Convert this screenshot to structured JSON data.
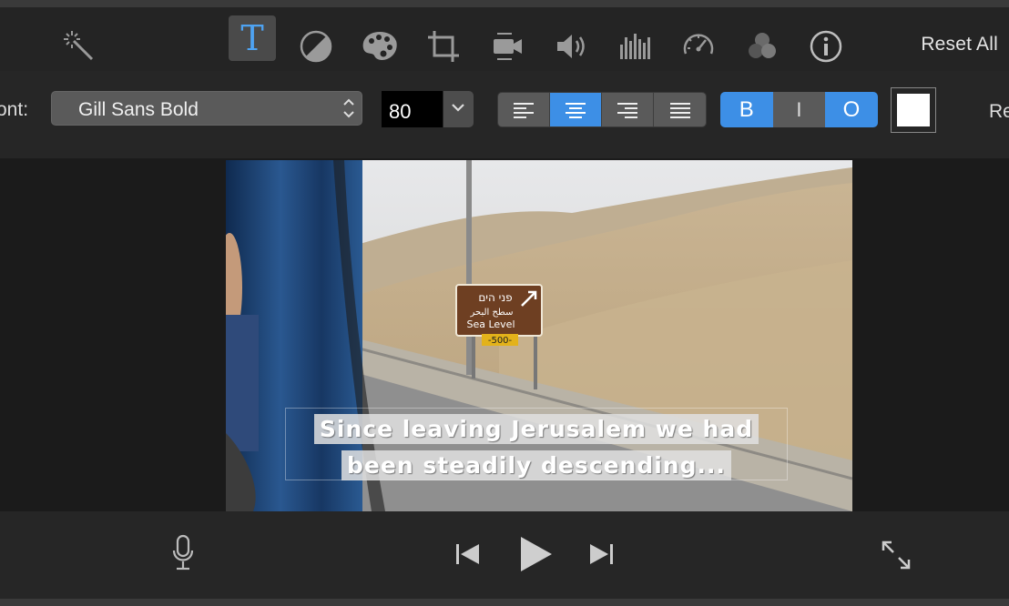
{
  "toolbar": {
    "tools": [
      {
        "name": "magic-wand-icon"
      },
      {
        "name": "title-text-icon",
        "active": true
      },
      {
        "name": "color-balance-icon"
      },
      {
        "name": "color-palette-icon"
      },
      {
        "name": "crop-icon"
      },
      {
        "name": "stabilization-camera-icon"
      },
      {
        "name": "volume-icon"
      },
      {
        "name": "equalizer-icon"
      },
      {
        "name": "speed-icon"
      },
      {
        "name": "clip-filter-icon"
      },
      {
        "name": "info-icon"
      }
    ],
    "reset_all_label": "Reset All"
  },
  "title_settings": {
    "font_label": "ont:",
    "font_value": "Gill Sans Bold",
    "size_value": "80",
    "alignment_selected": "center",
    "style_buttons": [
      "B",
      "I",
      "O"
    ],
    "style_active": {
      "B": true,
      "I": false,
      "O": true
    },
    "text_color": "#ffffff",
    "right_cut_label": "Re"
  },
  "viewer": {
    "caption_lines": [
      "Since leaving Jerusalem we had",
      "been steadily descending..."
    ],
    "sign": {
      "hebrew": "פני הים",
      "arabic": "سطح البحر",
      "english": "Sea Level",
      "plate": "-500-"
    }
  },
  "controls": {
    "voiceover": "microphone-icon",
    "previous": "skip-previous-icon",
    "play": "play-icon",
    "next": "skip-next-icon",
    "fullscreen": "fullscreen-icon"
  },
  "colors": {
    "accent": "#3d8fe6",
    "background": "#1e1e1e"
  }
}
